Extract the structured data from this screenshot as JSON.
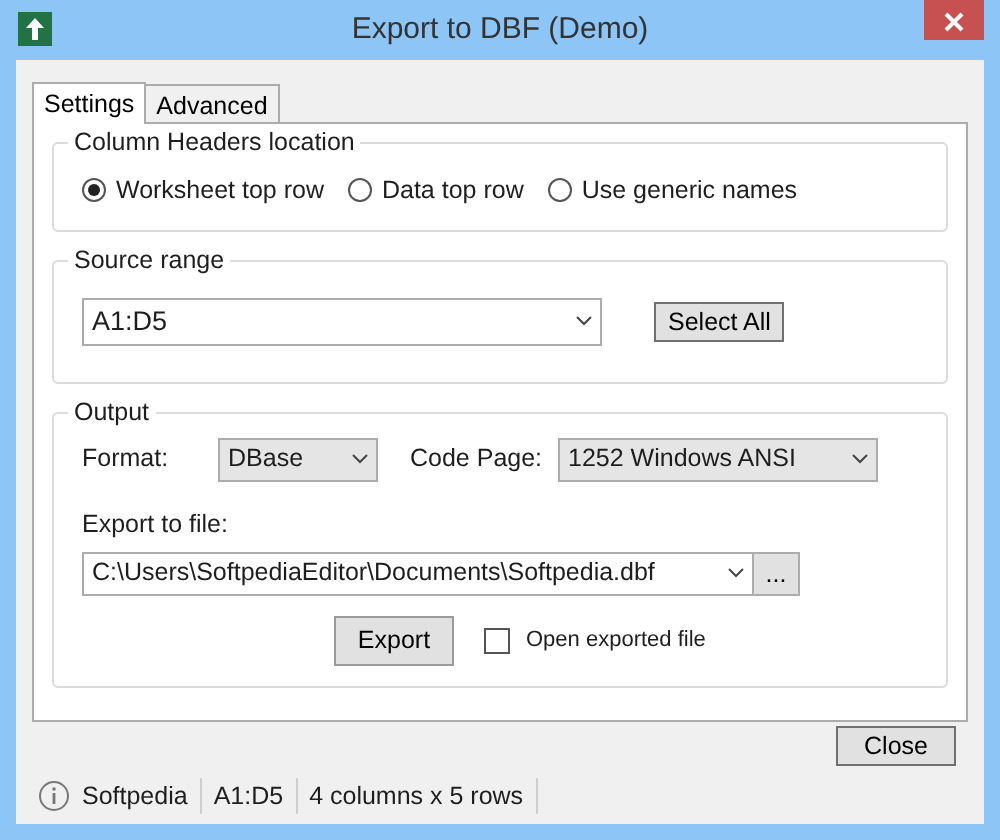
{
  "window": {
    "title": "Export to DBF (Demo)"
  },
  "tabs": [
    {
      "label": "Settings",
      "selected": true
    },
    {
      "label": "Advanced",
      "selected": false
    }
  ],
  "column_headers": {
    "title": "Column Headers location",
    "options": [
      {
        "label": "Worksheet top row",
        "selected": true
      },
      {
        "label": "Data top row",
        "selected": false
      },
      {
        "label": "Use generic names",
        "selected": false
      }
    ]
  },
  "source_range": {
    "title": "Source range",
    "value": "A1:D5",
    "button": "Select All"
  },
  "output": {
    "title": "Output",
    "format_label": "Format:",
    "format_value": "DBase",
    "code_page_label": "Code Page:",
    "code_page_value": "1252 Windows ANSI",
    "export_label": "Export to file:",
    "file_path": "C:\\Users\\SoftpediaEditor\\Documents\\Softpedia.dbf",
    "browse_button": "...",
    "export_button": "Export",
    "open_exported": {
      "label": "Open exported file",
      "checked": false
    }
  },
  "close_button": "Close",
  "status_bar": [
    "Softpedia",
    "A1:D5",
    "4 columns x 5 rows"
  ]
}
